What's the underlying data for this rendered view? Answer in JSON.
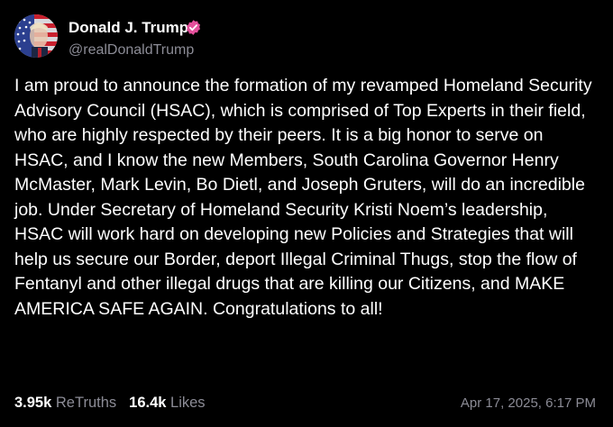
{
  "author": {
    "display_name": "Donald J. Trump",
    "handle": "@realDonaldTrump",
    "avatar_icon": "flag-portrait-avatar",
    "verified_icon": "verified-badge-icon",
    "verified_color": "#e44f9b"
  },
  "post": {
    "text": "I am proud to announce the formation of my revamped Homeland Security Advisory Council (HSAC), which is comprised of Top Experts in their field, who are highly respected by their peers. It is a big honor to serve on HSAC, and I know the new Members, South Carolina Governor Henry McMaster, Mark Levin, Bo Dietl, and Joseph Gruters, will do an incredible job. Under Secretary of Homeland Security Kristi Noem’s leadership, HSAC will work hard on developing new Policies and Strategies that will help us secure our Border, deport Illegal Criminal Thugs, stop the flow of Fentanyl and other illegal drugs that are killing our Citizens, and MAKE AMERICA SAFE AGAIN. Congratulations to all!",
    "timestamp": "Apr 17, 2025, 6:17 PM"
  },
  "stats": {
    "retruths_count": "3.95k",
    "retruths_label": "ReTruths",
    "likes_count": "16.4k",
    "likes_label": "Likes"
  },
  "colors": {
    "background": "#000000",
    "text": "#ffffff",
    "muted": "#8c8c96"
  }
}
